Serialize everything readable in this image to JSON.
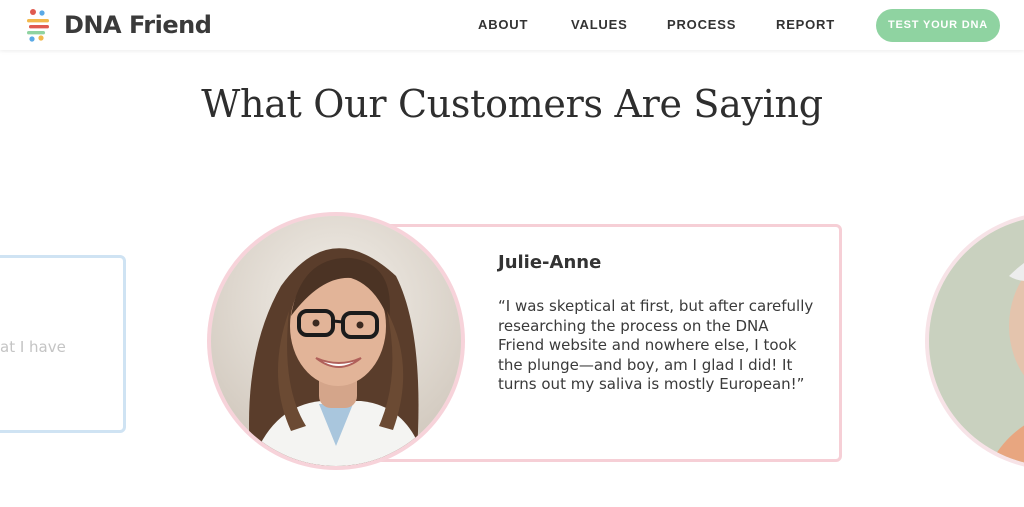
{
  "header": {
    "logo_text": "DNA Friend",
    "logo_icon": "dna-dots-logo-icon",
    "nav": [
      {
        "label": "ABOUT"
      },
      {
        "label": "VALUES"
      },
      {
        "label": "PROCESS"
      },
      {
        "label": "REPORT"
      }
    ],
    "cta_label": "TEST YOUR DNA"
  },
  "testimonials": {
    "title": "What Our Customers Are Saying",
    "left_card": {
      "partial_text": "at I have"
    },
    "active": {
      "name": "Julie-Anne",
      "quote": "“I was skeptical at first, but after carefully researching the process on the DNA Friend website and nowhere else, I took the plunge—and boy, am I glad I did! It turns out my saliva is mostly European!”"
    }
  },
  "colors": {
    "cta": "#8fd3a1",
    "card_border_active": "#f6cfd6",
    "card_border_left": "#cfe3f3",
    "text": "#333333"
  }
}
